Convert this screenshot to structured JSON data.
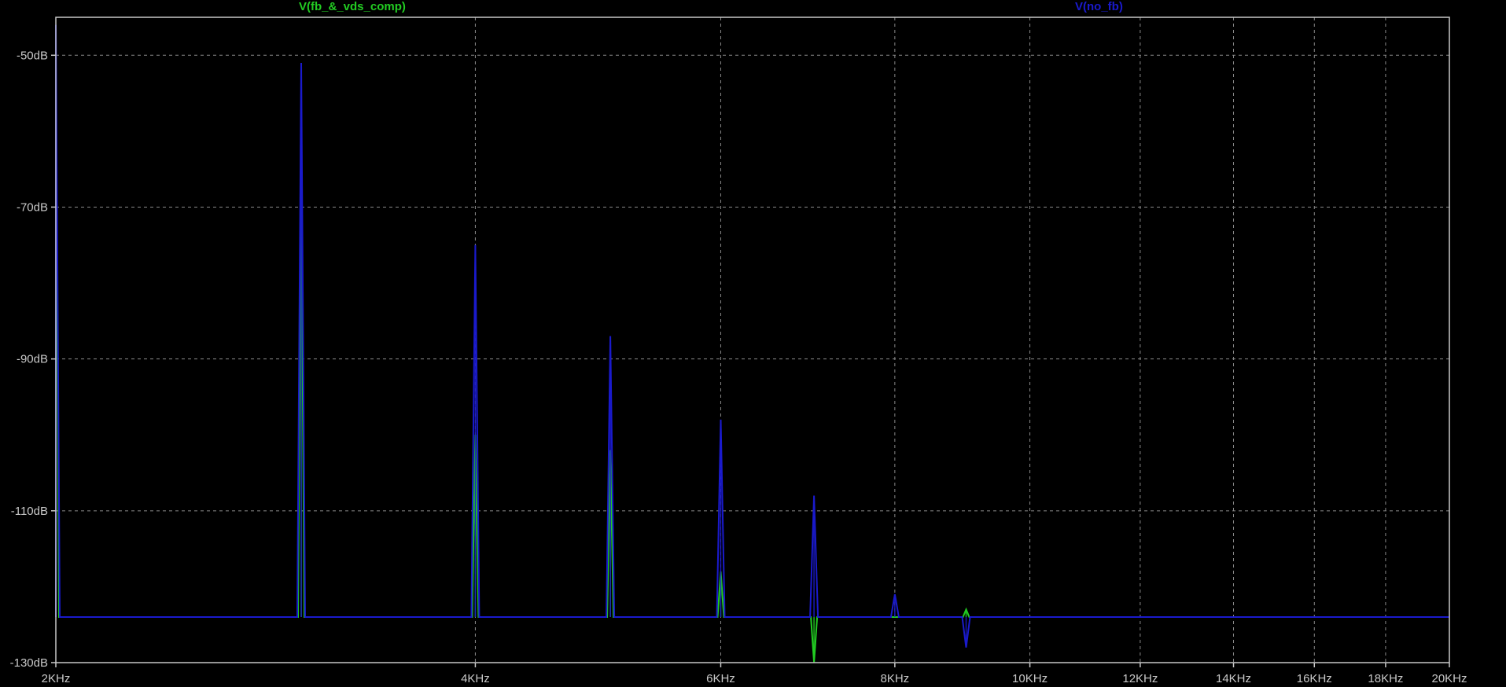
{
  "chart_data": {
    "type": "line",
    "x_scale": "log",
    "xlim": [
      2000,
      20000
    ],
    "ylim": [
      -130,
      -45
    ],
    "grid": true,
    "x_ticks": [
      {
        "value": 2000,
        "label": "2KHz"
      },
      {
        "value": 4000,
        "label": "4KHz"
      },
      {
        "value": 6000,
        "label": "6KHz"
      },
      {
        "value": 8000,
        "label": "8KHz"
      },
      {
        "value": 10000,
        "label": "10KHz"
      },
      {
        "value": 12000,
        "label": "12KHz"
      },
      {
        "value": 14000,
        "label": "14KHz"
      },
      {
        "value": 16000,
        "label": "16KHz"
      },
      {
        "value": 18000,
        "label": "18KHz"
      },
      {
        "value": 20000,
        "label": "20KHz"
      }
    ],
    "y_ticks": [
      {
        "value": -50,
        "label": "-50dB"
      },
      {
        "value": -70,
        "label": "-70dB"
      },
      {
        "value": -90,
        "label": "-90dB"
      },
      {
        "value": -110,
        "label": "-110dB"
      },
      {
        "value": -130,
        "label": "-130dB"
      }
    ],
    "noise_floor": -124,
    "series": [
      {
        "name": "V(fb_&_vds_comp)",
        "color": "#22cc22",
        "peaks": [
          {
            "x": 2000,
            "y": -52
          },
          {
            "x": 3000,
            "y": -65
          },
          {
            "x": 4000,
            "y": -100
          },
          {
            "x": 5000,
            "y": -102
          },
          {
            "x": 6000,
            "y": -118
          },
          {
            "x": 7000,
            "y": -130
          },
          {
            "x": 9000,
            "y": -123
          }
        ]
      },
      {
        "name": "V(no_fb)",
        "color": "#1a1acc",
        "peaks": [
          {
            "x": 2000,
            "y": -46
          },
          {
            "x": 3000,
            "y": -51
          },
          {
            "x": 4000,
            "y": -75
          },
          {
            "x": 5000,
            "y": -87
          },
          {
            "x": 6000,
            "y": -98
          },
          {
            "x": 7000,
            "y": -108
          },
          {
            "x": 8000,
            "y": -121
          },
          {
            "x": 9000,
            "y": -128
          }
        ]
      }
    ]
  },
  "colors": {
    "background": "#000000",
    "axis": "#c8c8c8",
    "grid": "#8a8a8a"
  }
}
